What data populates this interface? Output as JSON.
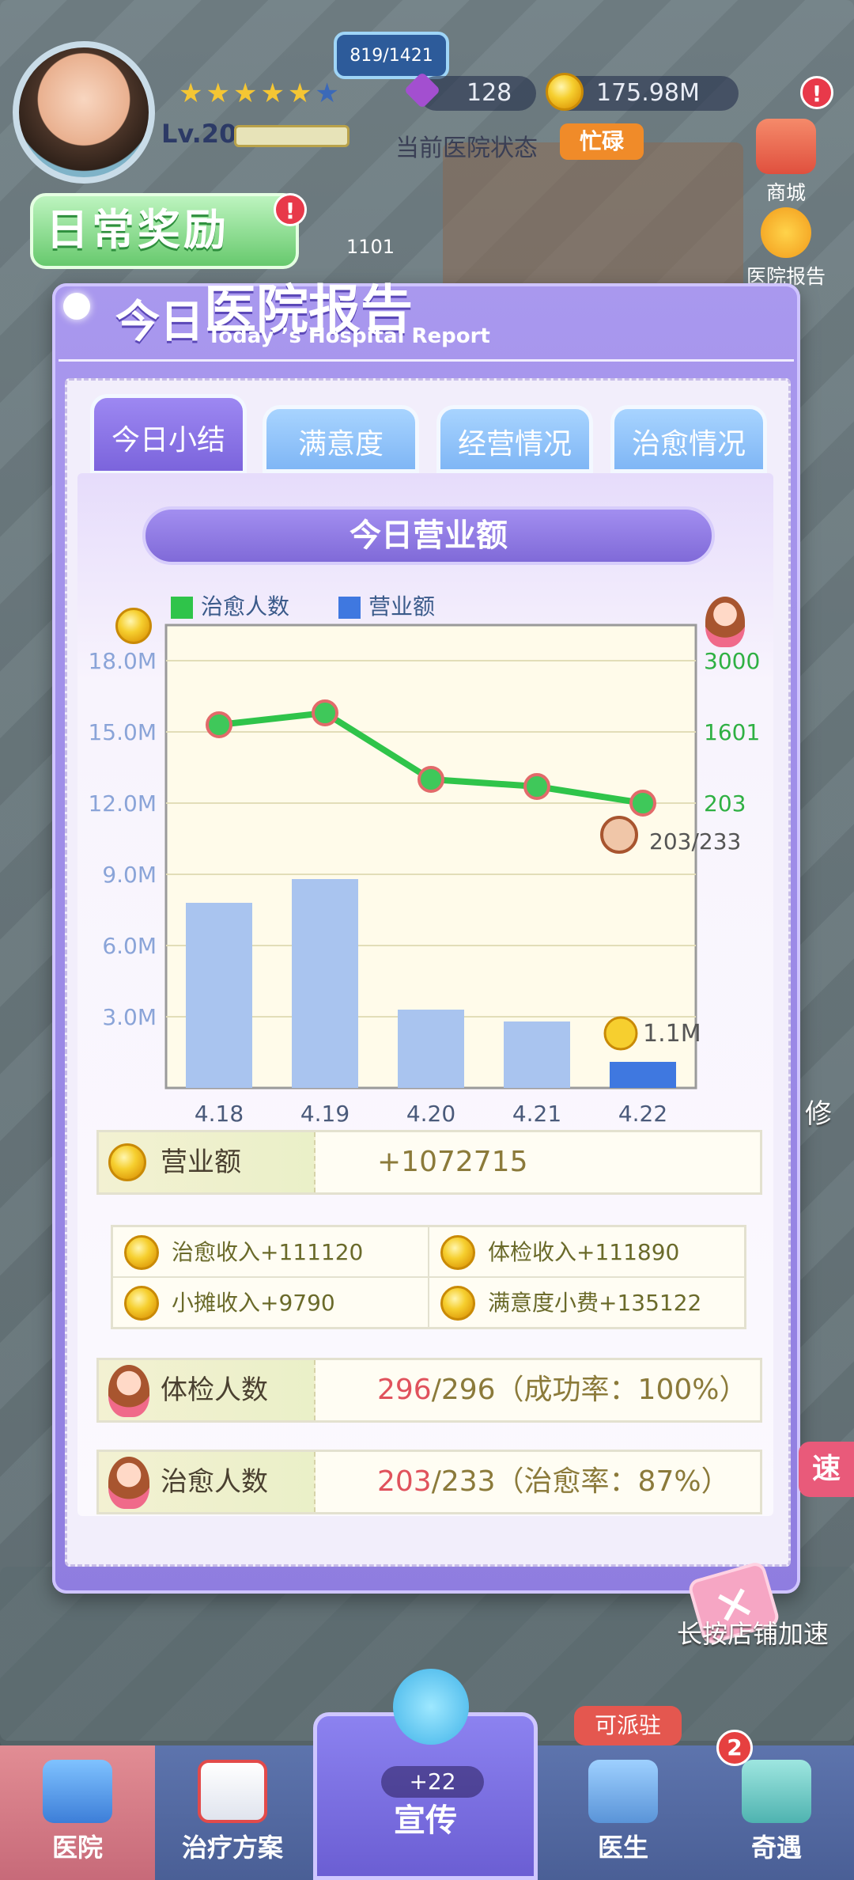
{
  "hud": {
    "capacity": "819/1421",
    "gems": "128",
    "coins": "175.98M",
    "level": "Lv.20",
    "stars_filled": 5,
    "stars_total": 6,
    "hospital_status_label": "当前医院状态",
    "hospital_status_value": "忙碌",
    "shop_label": "商城",
    "report_label": "医院报告",
    "daily_reward": "日常奖励",
    "alert_mark": "!",
    "room_number": "1101"
  },
  "modal": {
    "title_prefix": "今日",
    "title_main": "医院报告",
    "title_en": "Today ’s Hospital Report",
    "tabs": [
      {
        "label": "今日小结",
        "active": true
      },
      {
        "label": "满意度",
        "active": false
      },
      {
        "label": "经营情况",
        "active": false
      },
      {
        "label": "治愈情况",
        "active": false
      }
    ],
    "section_title": "今日营业额",
    "close_symbol": "✕"
  },
  "chart_data": {
    "type": "bar",
    "categories": [
      "4.18",
      "4.19",
      "4.20",
      "4.21",
      "4.22"
    ],
    "series": [
      {
        "name": "营业额",
        "values": [
          7.8,
          8.8,
          3.3,
          2.8,
          1.1
        ],
        "axis": "left",
        "units": "M",
        "color_past": "#a9c4ef",
        "color_today": "#3f78e0"
      },
      {
        "name": "治愈人数",
        "type": "line",
        "axis": "right",
        "color": "#2fc44a",
        "positions_in_left_units": [
          15.3,
          15.8,
          13.0,
          12.7,
          12.0
        ]
      }
    ],
    "left_ticks": [
      "3.0M",
      "6.0M",
      "9.0M",
      "12.0M",
      "15.0M",
      "18.0M"
    ],
    "left_tick_values": [
      3,
      6,
      9,
      12,
      15,
      18
    ],
    "right_ticks": [
      "203",
      "1601",
      "3000"
    ],
    "right_tick_values_in_left_units": [
      12,
      15,
      18
    ],
    "ylim": [
      0,
      19.5
    ],
    "grid": true,
    "legend_position": "top-left",
    "annotation_today_bar": "1.1M",
    "annotation_today_line": "203/233"
  },
  "stats": {
    "revenue_label": "营业额",
    "revenue_value": "+1072715",
    "income_items": [
      {
        "label": "治愈收入+111120"
      },
      {
        "label": "体检收入+111890"
      },
      {
        "label": "小摊收入+9790"
      },
      {
        "label": "满意度小费+135122"
      }
    ],
    "checkup_label": "体检人数",
    "checkup_done": "296",
    "checkup_rest": "/296（成功率：100%）",
    "cure_label": "治愈人数",
    "cure_done": "203",
    "cure_rest": "/233（治愈率：87%）"
  },
  "side": {
    "speed_label": "速",
    "hint_label": "长按店铺加速",
    "repair_label": "修"
  },
  "nav": {
    "items": [
      "医院",
      "治疗方案",
      "宣传",
      "医生",
      "奇遇"
    ],
    "promo_count": "+22",
    "dispatch_label": "可派驻",
    "encounter_badge": "2"
  },
  "colors": {
    "accent_purple": "#8f7de0",
    "cure_green": "#2fc44a",
    "revenue_blue": "#3f78e0",
    "highlight_red": "#e0525c"
  }
}
